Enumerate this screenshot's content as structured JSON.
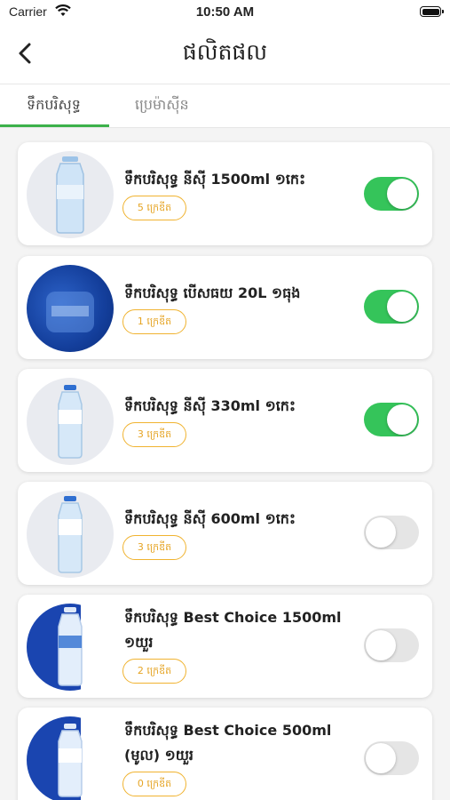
{
  "status_bar": {
    "carrier": "Carrier",
    "time": "10:50 AM"
  },
  "header": {
    "title": "ផលិតផល"
  },
  "tabs": [
    {
      "label": "ទឹកបរិសុទ្ធ",
      "active": true
    },
    {
      "label": "ប្រេម៉ាស៊ីន",
      "active": false
    }
  ],
  "colors": {
    "accent": "#3cb14a",
    "toggle_on": "#35c45a",
    "badge": "#f0b330"
  },
  "products": [
    {
      "name": "ទឹកបរិសុទ្ធ នីស៊ី 1500ml ១កេះ",
      "credits": "5 ក្រេឌីត",
      "enabled": true
    },
    {
      "name": "ទឹកបរិសុទ្ធ បើសធយ 20L ១ធុង",
      "credits": "1 ក្រេឌីត",
      "enabled": true
    },
    {
      "name": "ទឹកបរិសុទ្ធ នីស៊ី 330ml ១កេះ",
      "credits": "3 ក្រេឌីត",
      "enabled": true
    },
    {
      "name": "ទឹកបរិសុទ្ធ នីស៊ី 600ml ១កេះ",
      "credits": "3 ក្រេឌីត",
      "enabled": false
    },
    {
      "name": "ទឹកបរិសុទ្ធ Best Choice 1500ml ១យួរ",
      "credits": "2 ក្រេឌីត",
      "enabled": false
    },
    {
      "name": "ទឹកបរិសុទ្ធ Best Choice 500ml (មូល) ១យួរ",
      "credits": "0 ក្រេឌីត",
      "enabled": false
    }
  ]
}
